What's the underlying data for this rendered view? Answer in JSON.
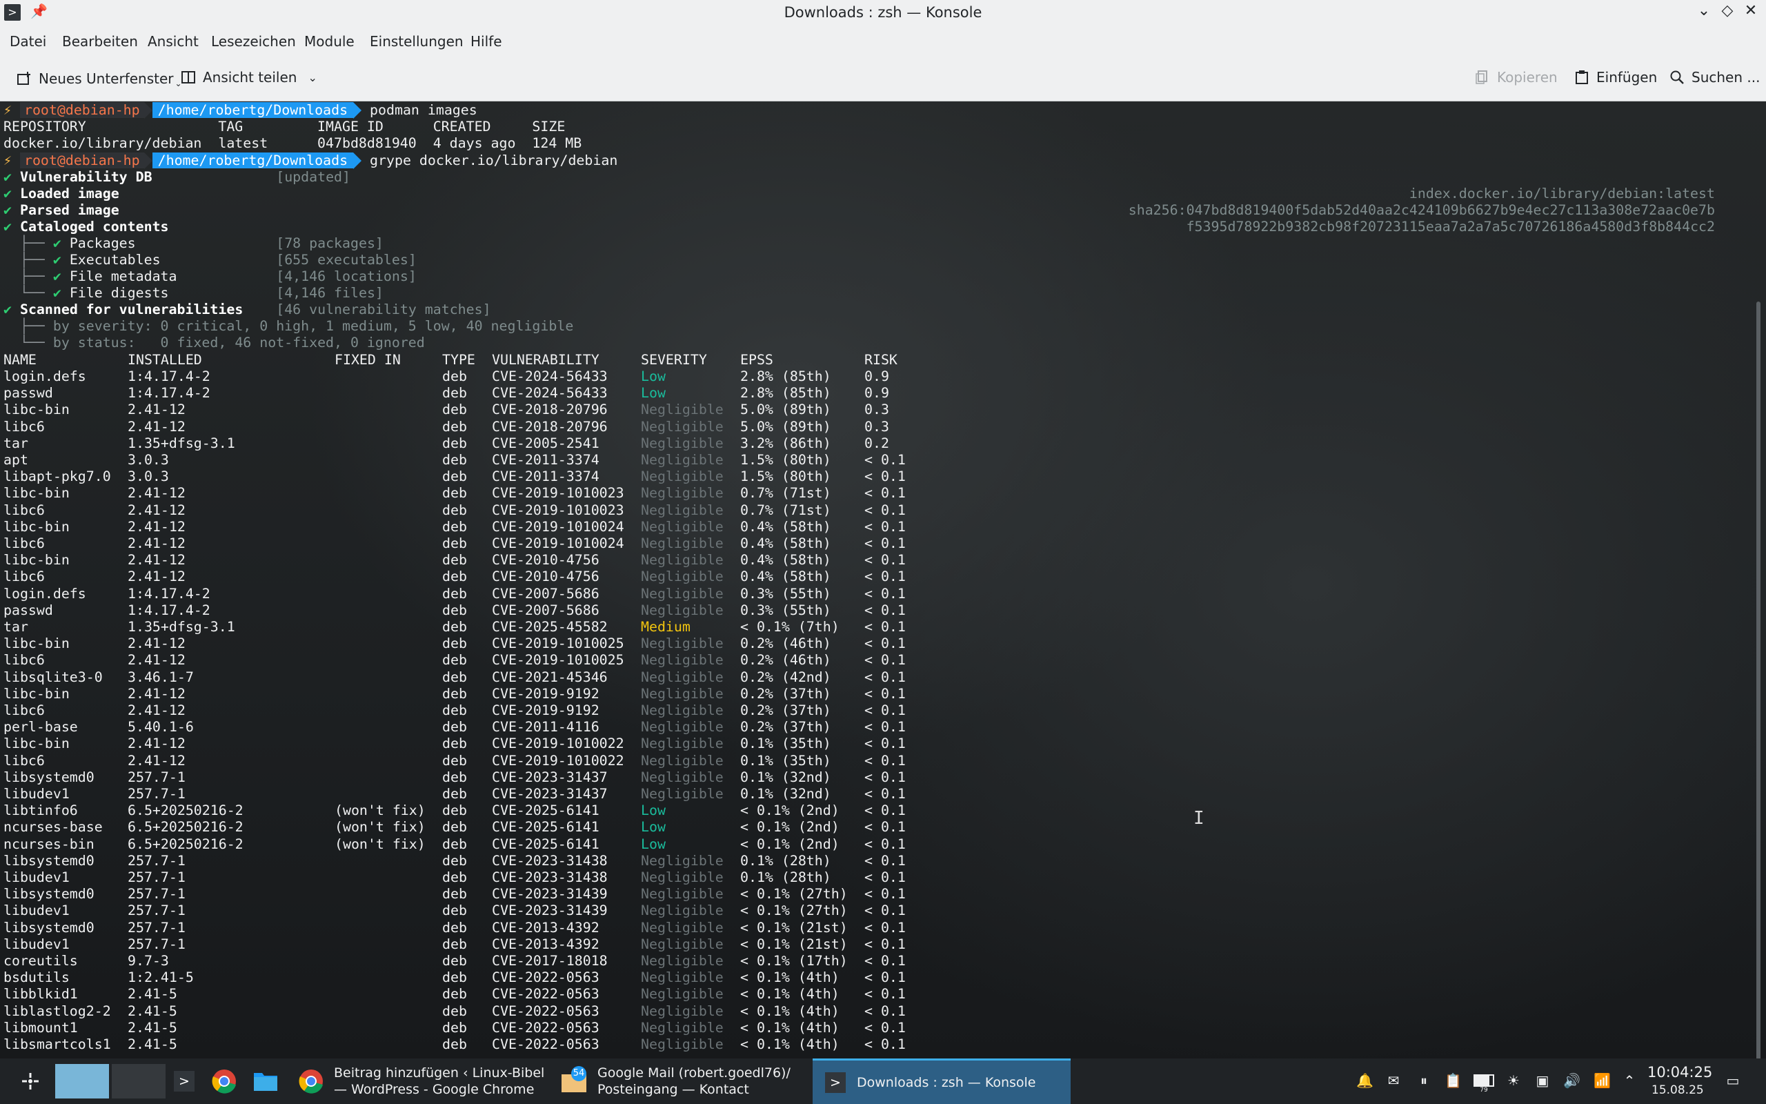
{
  "window": {
    "title": "Downloads : zsh — Konsole"
  },
  "menubar": [
    "Datei",
    "Bearbeiten",
    "Ansicht",
    "Lesezeichen",
    "Module",
    "Einstellungen",
    "Hilfe"
  ],
  "toolbar": {
    "new_tab": "Neues Unterfenster",
    "split_view": "Ansicht teilen",
    "copy": "Kopieren",
    "paste": "Einfügen",
    "find": "Suchen ..."
  },
  "prompt": {
    "bolt": "⚡",
    "user": "root@debian-hp",
    "path": "/home/robertg/Downloads"
  },
  "commands": {
    "cmd1": "podman images",
    "cmd2": "grype docker.io/library/debian"
  },
  "podman": {
    "header": "REPOSITORY                TAG         IMAGE ID      CREATED     SIZE",
    "row": "docker.io/library/debian  latest      047bd8d81940  4 days ago  124 MB"
  },
  "grype_status": [
    {
      "text": "Vulnerability DB",
      "note": "[updated]"
    },
    {
      "text": "Loaded image",
      "note": ""
    },
    {
      "text": "Parsed image",
      "note": ""
    },
    {
      "text": "Cataloged contents",
      "note": ""
    }
  ],
  "catalog": [
    {
      "text": "Packages",
      "note": "[78 packages]"
    },
    {
      "text": "Executables",
      "note": "[655 executables]"
    },
    {
      "text": "File metadata",
      "note": "[4,146 locations]"
    },
    {
      "text": "File digests",
      "note": "[4,146 files]"
    }
  ],
  "scan": {
    "text": "Scanned for vulnerabilities",
    "note": "[46 vulnerability matches]",
    "by_severity": "by severity: 0 critical, 0 high, 1 medium, 5 low, 40 negligible",
    "by_status": "by status:   0 fixed, 46 not-fixed, 0 ignored"
  },
  "image_ref": [
    "index.docker.io/library/debian:latest",
    "sha256:047bd8d819400f5dab52d40aa2c424109b6627b9e4ec27c113a308e72aac0e7b",
    "f5395d78922b9382cb98f20723115eaa7a2a7a5c70726186a4580d3f8b844cc2"
  ],
  "table": {
    "headers": [
      "NAME",
      "INSTALLED",
      "FIXED IN",
      "TYPE",
      "VULNERABILITY",
      "SEVERITY",
      "EPSS",
      "RISK"
    ],
    "rows": [
      [
        "login.defs",
        "1:4.17.4-2",
        "",
        "deb",
        "CVE-2024-56433",
        "Low",
        "2.8% (85th)",
        "0.9"
      ],
      [
        "passwd",
        "1:4.17.4-2",
        "",
        "deb",
        "CVE-2024-56433",
        "Low",
        "2.8% (85th)",
        "0.9"
      ],
      [
        "libc-bin",
        "2.41-12",
        "",
        "deb",
        "CVE-2018-20796",
        "Negligible",
        "5.0% (89th)",
        "0.3"
      ],
      [
        "libc6",
        "2.41-12",
        "",
        "deb",
        "CVE-2018-20796",
        "Negligible",
        "5.0% (89th)",
        "0.3"
      ],
      [
        "tar",
        "1.35+dfsg-3.1",
        "",
        "deb",
        "CVE-2005-2541",
        "Negligible",
        "3.2% (86th)",
        "0.2"
      ],
      [
        "apt",
        "3.0.3",
        "",
        "deb",
        "CVE-2011-3374",
        "Negligible",
        "1.5% (80th)",
        "< 0.1"
      ],
      [
        "libapt-pkg7.0",
        "3.0.3",
        "",
        "deb",
        "CVE-2011-3374",
        "Negligible",
        "1.5% (80th)",
        "< 0.1"
      ],
      [
        "libc-bin",
        "2.41-12",
        "",
        "deb",
        "CVE-2019-1010023",
        "Negligible",
        "0.7% (71st)",
        "< 0.1"
      ],
      [
        "libc6",
        "2.41-12",
        "",
        "deb",
        "CVE-2019-1010023",
        "Negligible",
        "0.7% (71st)",
        "< 0.1"
      ],
      [
        "libc-bin",
        "2.41-12",
        "",
        "deb",
        "CVE-2019-1010024",
        "Negligible",
        "0.4% (58th)",
        "< 0.1"
      ],
      [
        "libc6",
        "2.41-12",
        "",
        "deb",
        "CVE-2019-1010024",
        "Negligible",
        "0.4% (58th)",
        "< 0.1"
      ],
      [
        "libc-bin",
        "2.41-12",
        "",
        "deb",
        "CVE-2010-4756",
        "Negligible",
        "0.4% (58th)",
        "< 0.1"
      ],
      [
        "libc6",
        "2.41-12",
        "",
        "deb",
        "CVE-2010-4756",
        "Negligible",
        "0.4% (58th)",
        "< 0.1"
      ],
      [
        "login.defs",
        "1:4.17.4-2",
        "",
        "deb",
        "CVE-2007-5686",
        "Negligible",
        "0.3% (55th)",
        "< 0.1"
      ],
      [
        "passwd",
        "1:4.17.4-2",
        "",
        "deb",
        "CVE-2007-5686",
        "Negligible",
        "0.3% (55th)",
        "< 0.1"
      ],
      [
        "tar",
        "1.35+dfsg-3.1",
        "",
        "deb",
        "CVE-2025-45582",
        "Medium",
        "< 0.1% (7th)",
        "< 0.1"
      ],
      [
        "libc-bin",
        "2.41-12",
        "",
        "deb",
        "CVE-2019-1010025",
        "Negligible",
        "0.2% (46th)",
        "< 0.1"
      ],
      [
        "libc6",
        "2.41-12",
        "",
        "deb",
        "CVE-2019-1010025",
        "Negligible",
        "0.2% (46th)",
        "< 0.1"
      ],
      [
        "libsqlite3-0",
        "3.46.1-7",
        "",
        "deb",
        "CVE-2021-45346",
        "Negligible",
        "0.2% (42nd)",
        "< 0.1"
      ],
      [
        "libc-bin",
        "2.41-12",
        "",
        "deb",
        "CVE-2019-9192",
        "Negligible",
        "0.2% (37th)",
        "< 0.1"
      ],
      [
        "libc6",
        "2.41-12",
        "",
        "deb",
        "CVE-2019-9192",
        "Negligible",
        "0.2% (37th)",
        "< 0.1"
      ],
      [
        "perl-base",
        "5.40.1-6",
        "",
        "deb",
        "CVE-2011-4116",
        "Negligible",
        "0.2% (37th)",
        "< 0.1"
      ],
      [
        "libc-bin",
        "2.41-12",
        "",
        "deb",
        "CVE-2019-1010022",
        "Negligible",
        "0.1% (35th)",
        "< 0.1"
      ],
      [
        "libc6",
        "2.41-12",
        "",
        "deb",
        "CVE-2019-1010022",
        "Negligible",
        "0.1% (35th)",
        "< 0.1"
      ],
      [
        "libsystemd0",
        "257.7-1",
        "",
        "deb",
        "CVE-2023-31437",
        "Negligible",
        "0.1% (32nd)",
        "< 0.1"
      ],
      [
        "libudev1",
        "257.7-1",
        "",
        "deb",
        "CVE-2023-31437",
        "Negligible",
        "0.1% (32nd)",
        "< 0.1"
      ],
      [
        "libtinfo6",
        "6.5+20250216-2",
        "(won't fix)",
        "deb",
        "CVE-2025-6141",
        "Low",
        "< 0.1% (2nd)",
        "< 0.1"
      ],
      [
        "ncurses-base",
        "6.5+20250216-2",
        "(won't fix)",
        "deb",
        "CVE-2025-6141",
        "Low",
        "< 0.1% (2nd)",
        "< 0.1"
      ],
      [
        "ncurses-bin",
        "6.5+20250216-2",
        "(won't fix)",
        "deb",
        "CVE-2025-6141",
        "Low",
        "< 0.1% (2nd)",
        "< 0.1"
      ],
      [
        "libsystemd0",
        "257.7-1",
        "",
        "deb",
        "CVE-2023-31438",
        "Negligible",
        "0.1% (28th)",
        "< 0.1"
      ],
      [
        "libudev1",
        "257.7-1",
        "",
        "deb",
        "CVE-2023-31438",
        "Negligible",
        "0.1% (28th)",
        "< 0.1"
      ],
      [
        "libsystemd0",
        "257.7-1",
        "",
        "deb",
        "CVE-2023-31439",
        "Negligible",
        "< 0.1% (27th)",
        "< 0.1"
      ],
      [
        "libudev1",
        "257.7-1",
        "",
        "deb",
        "CVE-2023-31439",
        "Negligible",
        "< 0.1% (27th)",
        "< 0.1"
      ],
      [
        "libsystemd0",
        "257.7-1",
        "",
        "deb",
        "CVE-2013-4392",
        "Negligible",
        "< 0.1% (21st)",
        "< 0.1"
      ],
      [
        "libudev1",
        "257.7-1",
        "",
        "deb",
        "CVE-2013-4392",
        "Negligible",
        "< 0.1% (21st)",
        "< 0.1"
      ],
      [
        "coreutils",
        "9.7-3",
        "",
        "deb",
        "CVE-2017-18018",
        "Negligible",
        "< 0.1% (17th)",
        "< 0.1"
      ],
      [
        "bsdutils",
        "1:2.41-5",
        "",
        "deb",
        "CVE-2022-0563",
        "Negligible",
        "< 0.1% (4th)",
        "< 0.1"
      ],
      [
        "libblkid1",
        "2.41-5",
        "",
        "deb",
        "CVE-2022-0563",
        "Negligible",
        "< 0.1% (4th)",
        "< 0.1"
      ],
      [
        "liblastlog2-2",
        "2.41-5",
        "",
        "deb",
        "CVE-2022-0563",
        "Negligible",
        "< 0.1% (4th)",
        "< 0.1"
      ],
      [
        "libmount1",
        "2.41-5",
        "",
        "deb",
        "CVE-2022-0563",
        "Negligible",
        "< 0.1% (4th)",
        "< 0.1"
      ],
      [
        "libsmartcols1",
        "2.41-5",
        "",
        "deb",
        "CVE-2022-0563",
        "Negligible",
        "< 0.1% (4th)",
        "< 0.1"
      ]
    ]
  },
  "taskbar": {
    "tasks": [
      {
        "label1": "Beitrag hinzufügen ‹ Linux-Bibel",
        "label2": "— WordPress - Google Chrome"
      },
      {
        "label1": "Google Mail (robert.goedl76)/",
        "label2": "Posteingang — Kontact",
        "badge": "54"
      },
      {
        "label1": "Downloads : zsh — Konsole",
        "label2": ""
      }
    ],
    "battery": "79",
    "clock_time": "10:04:25",
    "clock_date": "15.08.25"
  },
  "colors": {
    "accent": "#1d99f3",
    "low": "#1abc9c",
    "medium": "#f1c40f",
    "negligible": "#6b7376",
    "check": "#2ecc71"
  }
}
